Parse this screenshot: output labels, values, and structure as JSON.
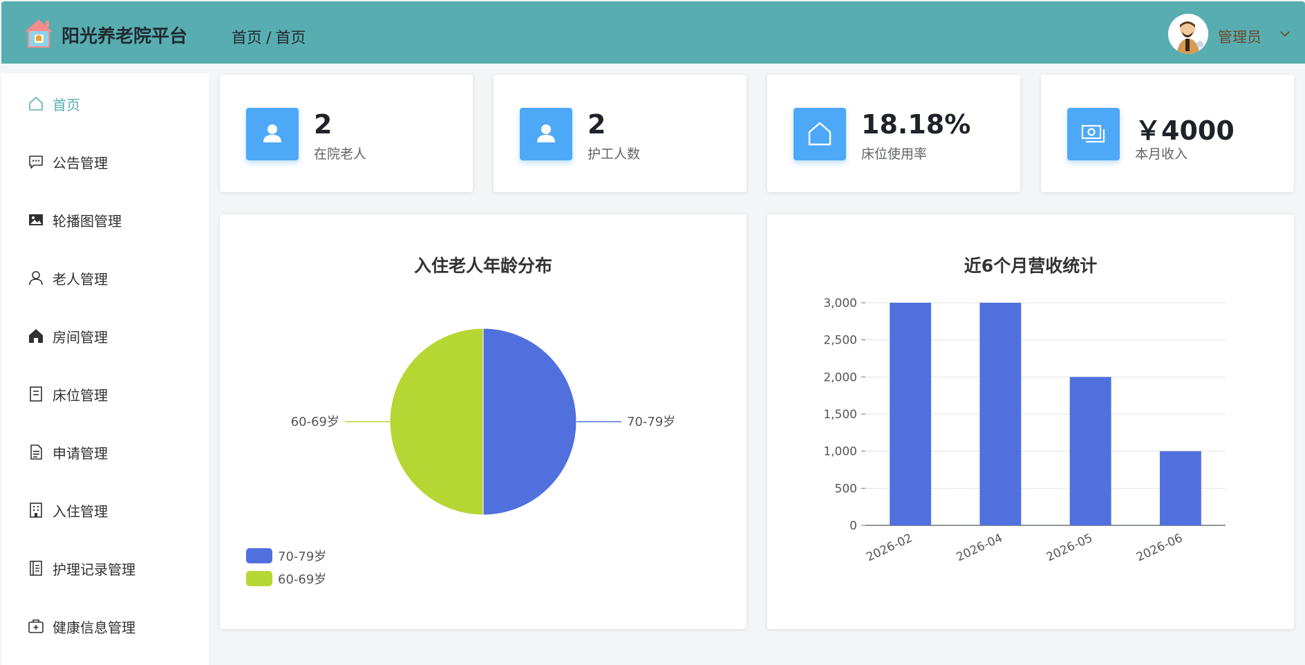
{
  "header": {
    "app_title": "阳光养老院平台",
    "breadcrumb": [
      "首页",
      "首页"
    ],
    "user_name": "管理员",
    "bg_color": "#58adb1"
  },
  "sidebar": {
    "items": [
      {
        "label": "首页",
        "icon": "home-icon",
        "active": true
      },
      {
        "label": "公告管理",
        "icon": "chat-dots-icon"
      },
      {
        "label": "轮播图管理",
        "icon": "picture-icon"
      },
      {
        "label": "老人管理",
        "icon": "user-icon"
      },
      {
        "label": "房间管理",
        "icon": "house-filled-icon"
      },
      {
        "label": "床位管理",
        "icon": "tickets-icon"
      },
      {
        "label": "申请管理",
        "icon": "document-icon"
      },
      {
        "label": "入住管理",
        "icon": "office-building-icon"
      },
      {
        "label": "护理记录管理",
        "icon": "notebook-icon"
      },
      {
        "label": "健康信息管理",
        "icon": "first-aid-kit-icon"
      }
    ]
  },
  "stats": [
    {
      "value": "2",
      "label": "在院老人",
      "icon": "user-filled-icon"
    },
    {
      "value": "2",
      "label": "护工人数",
      "icon": "user-filled-icon"
    },
    {
      "value": "18.18%",
      "label": "床位使用率",
      "icon": "house-outline-icon"
    },
    {
      "value": "￥4000",
      "label": "本月收入",
      "icon": "money-icon"
    }
  ],
  "accent_color": "#4ea8f8",
  "chart_data": [
    {
      "type": "pie",
      "title": "入住老人年龄分布",
      "labels": [
        "70-79岁",
        "60-69岁"
      ],
      "values": [
        1,
        1
      ],
      "colors": [
        "#5070dd",
        "#b6d634"
      ],
      "legend_position": "bottom-left"
    },
    {
      "type": "bar",
      "title": "近6个月营收统计",
      "categories": [
        "2026-02",
        "2026-04",
        "2026-05",
        "2026-06"
      ],
      "values": [
        3000,
        3000,
        2000,
        1000
      ],
      "ylim": [
        0,
        3000
      ],
      "yticks": [
        "0",
        "500",
        "1,000",
        "1,500",
        "2,000",
        "2,500",
        "3,000"
      ],
      "color": "#5070dd",
      "grid": true
    }
  ]
}
